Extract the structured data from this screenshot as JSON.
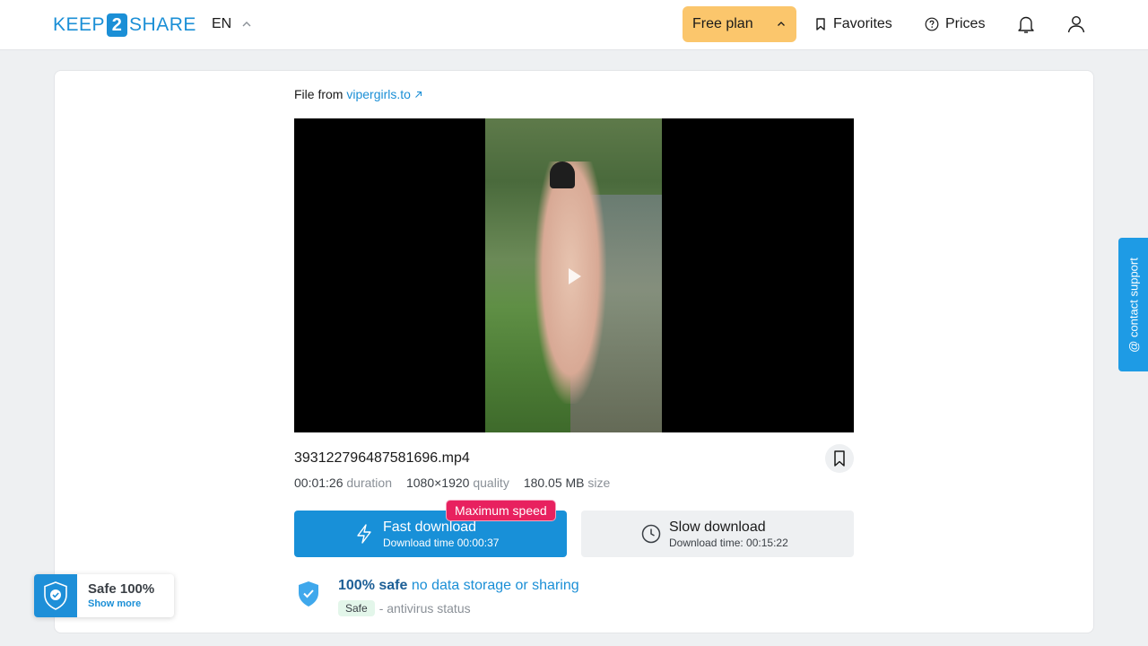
{
  "header": {
    "logo_left": "KEEP",
    "logo_mid": "2",
    "logo_right": "SHARE",
    "language": "EN",
    "plan_label": "Free plan",
    "favorites_label": "Favorites",
    "prices_label": "Prices"
  },
  "file": {
    "from_prefix": "File from",
    "source": "vipergirls.to",
    "name": "393122796487581696.mp4",
    "duration": "00:01:26",
    "duration_label": "duration",
    "quality": "1080×1920",
    "quality_label": "quality",
    "size": "180.05 MB",
    "size_label": "size"
  },
  "download": {
    "fast_label": "Fast download",
    "fast_time": "Download time 00:00:37",
    "badge": "Maximum speed",
    "slow_label": "Slow download",
    "slow_time": "Download time: 00:15:22"
  },
  "safety": {
    "bold": "100% safe",
    "rest": "no data storage or sharing",
    "status_tag": "Safe",
    "status_text": "- antivirus status"
  },
  "widget": {
    "title": "Safe 100%",
    "link": "Show more"
  },
  "support": {
    "label": "@ contact support"
  },
  "colors": {
    "brand": "#1b8fd6",
    "plan": "#fbc66c",
    "badge": "#e8215f"
  }
}
